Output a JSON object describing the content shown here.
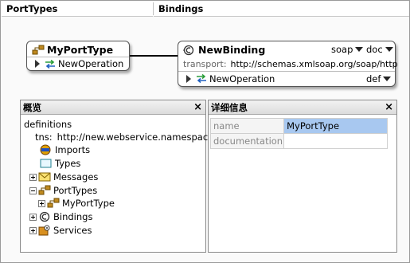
{
  "columns": {
    "porttypes": "PortTypes",
    "bindings": "Bindings"
  },
  "porttype_box": {
    "title": "MyPortType",
    "operation": "NewOperation"
  },
  "binding_box": {
    "title": "NewBinding",
    "style_value": "soap",
    "encoding_value": "doc",
    "transport_label": "transport:",
    "transport_value": "http://schemas.xmlsoap.org/soap/http",
    "operation": "NewOperation",
    "operation_mode": "def"
  },
  "overview_panel": {
    "title": "概览",
    "close": "×",
    "root": "definitions",
    "tns_label": "tns:",
    "tns_value": "http://new.webservice.namespace",
    "items": {
      "imports": "Imports",
      "types": "Types",
      "messages": "Messages",
      "porttypes": "PortTypes",
      "porttype_child": "MyPortType",
      "bindings": "Bindings",
      "services": "Services"
    }
  },
  "details_panel": {
    "title": "详细信息",
    "close": "×",
    "rows": [
      {
        "key": "name",
        "value": "MyPortType"
      },
      {
        "key": "documentation",
        "value": ""
      }
    ]
  },
  "colors": {
    "selection": "#a8c8f0",
    "operation_arrow_green": "#2a9d3a",
    "operation_arrow_blue": "#2060c0"
  }
}
